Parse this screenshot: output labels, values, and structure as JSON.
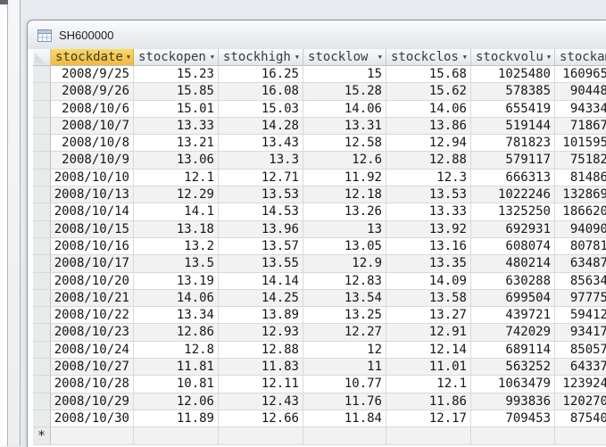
{
  "navigation": {
    "collapsed_pane": "shutter-bar"
  },
  "document": {
    "tab": {
      "icon": "table-grid-icon",
      "title": "SH600000"
    }
  },
  "datasheet": {
    "columns": [
      {
        "label": "stockdate",
        "dropdown": true,
        "selected": true
      },
      {
        "label": "stockopen",
        "dropdown": true,
        "selected": false
      },
      {
        "label": "stockhigh",
        "dropdown": true,
        "selected": false
      },
      {
        "label": "stocklow",
        "dropdown": true,
        "selected": false
      },
      {
        "label": "stockclos",
        "dropdown": true,
        "selected": false
      },
      {
        "label": "stockvolu",
        "dropdown": true,
        "selected": false
      },
      {
        "label": "stockam",
        "dropdown": false,
        "selected": false,
        "clipped": true
      }
    ],
    "rows": [
      [
        "2008/9/25",
        "15.23",
        "16.25",
        "15",
        "15.68",
        "1025480",
        "160965"
      ],
      [
        "2008/9/26",
        "15.85",
        "16.08",
        "15.28",
        "15.62",
        "578385",
        "90448"
      ],
      [
        "2008/10/6",
        "15.01",
        "15.03",
        "14.06",
        "14.06",
        "655419",
        "94334"
      ],
      [
        "2008/10/7",
        "13.33",
        "14.28",
        "13.31",
        "13.86",
        "519144",
        "71867"
      ],
      [
        "2008/10/8",
        "13.21",
        "13.43",
        "12.58",
        "12.94",
        "781823",
        "101595"
      ],
      [
        "2008/10/9",
        "13.06",
        "13.3",
        "12.6",
        "12.88",
        "579117",
        "75182"
      ],
      [
        "2008/10/10",
        "12.1",
        "12.71",
        "11.92",
        "12.3",
        "666313",
        "81486"
      ],
      [
        "2008/10/13",
        "12.29",
        "13.53",
        "12.18",
        "13.53",
        "1022246",
        "132869"
      ],
      [
        "2008/10/14",
        "14.1",
        "14.53",
        "13.26",
        "13.33",
        "1325250",
        "186620"
      ],
      [
        "2008/10/15",
        "13.18",
        "13.96",
        "13",
        "13.92",
        "692931",
        "94090"
      ],
      [
        "2008/10/16",
        "13.2",
        "13.57",
        "13.05",
        "13.16",
        "608074",
        "80781"
      ],
      [
        "2008/10/17",
        "13.5",
        "13.55",
        "12.9",
        "13.35",
        "480214",
        "63487"
      ],
      [
        "2008/10/20",
        "13.19",
        "14.14",
        "12.83",
        "14.09",
        "630288",
        "85634"
      ],
      [
        "2008/10/21",
        "14.06",
        "14.25",
        "13.54",
        "13.58",
        "699504",
        "97775"
      ],
      [
        "2008/10/22",
        "13.34",
        "13.89",
        "13.25",
        "13.27",
        "439721",
        "59412"
      ],
      [
        "2008/10/23",
        "12.86",
        "12.93",
        "12.27",
        "12.91",
        "742029",
        "93417"
      ],
      [
        "2008/10/24",
        "12.8",
        "12.88",
        "12",
        "12.14",
        "689114",
        "85057"
      ],
      [
        "2008/10/27",
        "11.81",
        "11.83",
        "11",
        "11.01",
        "563252",
        "64337"
      ],
      [
        "2008/10/28",
        "10.81",
        "12.11",
        "10.77",
        "12.1",
        "1063479",
        "123924"
      ],
      [
        "2008/10/29",
        "12.06",
        "12.43",
        "11.76",
        "11.86",
        "993836",
        "120270"
      ],
      [
        "2008/10/30",
        "11.89",
        "12.66",
        "11.84",
        "12.17",
        "709453",
        "87540"
      ]
    ],
    "new_record_marker": "*"
  },
  "colors": {
    "selected_header_top": "#FCD967",
    "selected_header_bottom": "#F2B93B",
    "header_top": "#F9FAFB",
    "header_bottom": "#E3E6EA",
    "grid_line": "#D9D9D9",
    "alt_row_bg": "#F2F2F2",
    "workspace_bg": "#E8ECF1",
    "window_border": "#8F949B"
  }
}
